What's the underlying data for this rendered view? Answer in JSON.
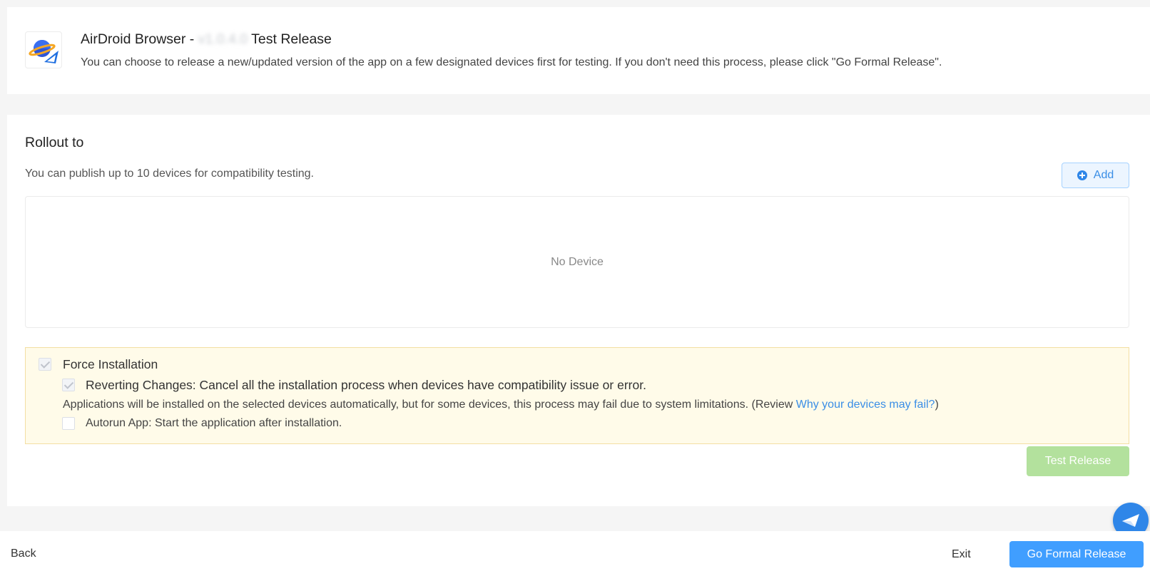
{
  "header": {
    "title_prefix": "AirDroid Browser - ",
    "version": "v1.0.4.0",
    "title_suffix": "Test Release",
    "description": "You can choose to release a new/updated version of the app on a few designated devices first for testing. If you don't need this process, please click \"Go Formal Release\"."
  },
  "rollout": {
    "title": "Rollout to",
    "description": "You can publish up to 10 devices for compatibility testing.",
    "add_label": "Add",
    "empty_text": "No Device"
  },
  "options": {
    "force_installation": "Force Installation",
    "force_installation_checked": true,
    "reverting_changes": "Reverting Changes: Cancel all the installation process when devices have compatibility issue or error.",
    "reverting_changes_checked": true,
    "auto_description": "Applications will be installed on the selected devices automatically, but for some devices, this process may fail due to system limitations. (Review ",
    "auto_link": "Why your devices may fail?",
    "auto_description_end": ")",
    "autorun": "Autorun App: Start the application after installation.",
    "autorun_checked": false
  },
  "actions": {
    "test_release": "Test Release",
    "back": "Back",
    "exit": "Exit",
    "go_formal_release": "Go Formal Release"
  },
  "colors": {
    "primary": "#409eff",
    "disabled_success": "#b3e19d",
    "notice_bg": "#fffbe9",
    "link": "#3a8ee6"
  }
}
